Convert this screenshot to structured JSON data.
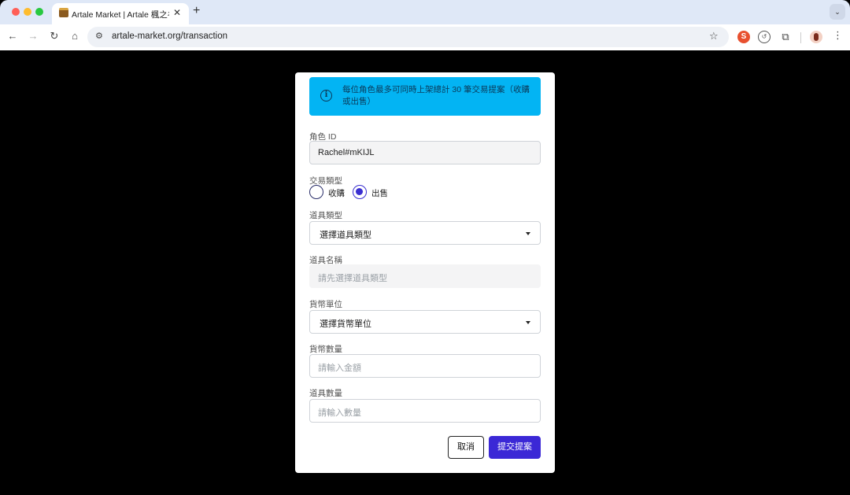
{
  "browser": {
    "tab_title": "Artale Market | Artale 楓之谷",
    "tab_close": "✕",
    "new_tab": "+",
    "url": "artale-market.org/transaction",
    "colors": {
      "chrome": "#dfe8f7",
      "alert": "#03b4f3",
      "primary": "#3b28d6"
    }
  },
  "form": {
    "notice": "每位角色最多可同時上架總計 30 筆交易提案（收購或出售）",
    "character_id": {
      "label": "角色 ID",
      "value": "Rachel#mKIJL"
    },
    "trade_type": {
      "label": "交易類型",
      "options": [
        "收購",
        "出售"
      ],
      "selected": "出售"
    },
    "item_type": {
      "label": "道具類型",
      "value": "選擇道具類型"
    },
    "item_name": {
      "label": "道具名稱",
      "placeholder": "請先選擇道具類型"
    },
    "currency_unit": {
      "label": "貨幣單位",
      "value": "選擇貨幣單位"
    },
    "currency_amount": {
      "label": "貨幣數量",
      "placeholder": "請輸入金額"
    },
    "item_quantity": {
      "label": "道具數量",
      "placeholder": "請輸入數量"
    },
    "cancel_label": "取消",
    "submit_label": "提交提案"
  }
}
